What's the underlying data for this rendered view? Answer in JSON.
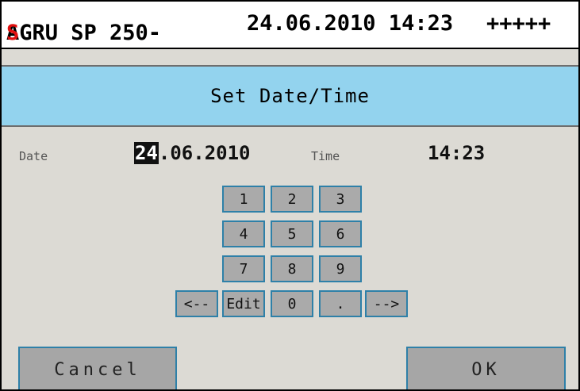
{
  "titlebar": {
    "model_prefix": "AGRU SP 250-",
    "model_suffix": "S",
    "datetime": "24.06.2010 14:23",
    "status": "+++++"
  },
  "header": {
    "title": "Set Date/Time"
  },
  "date": {
    "label": "Date",
    "cursor_digits": "24",
    "rest": ".06.2010"
  },
  "time": {
    "label": "Time",
    "value": "14:23"
  },
  "keypad": {
    "k1": "1",
    "k2": "2",
    "k3": "3",
    "k4": "4",
    "k5": "5",
    "k6": "6",
    "k7": "7",
    "k8": "8",
    "k9": "9",
    "left": "<--",
    "edit": "Edit",
    "k0": "0",
    "dot": ".",
    "right": "-->"
  },
  "buttons": {
    "cancel": "Cancel",
    "ok": "OK"
  },
  "colors": {
    "header_bg": "#93d3ee",
    "brand_accent": "#e01010",
    "key_border": "#2e80a8",
    "panel_bg": "#dcdad4"
  }
}
